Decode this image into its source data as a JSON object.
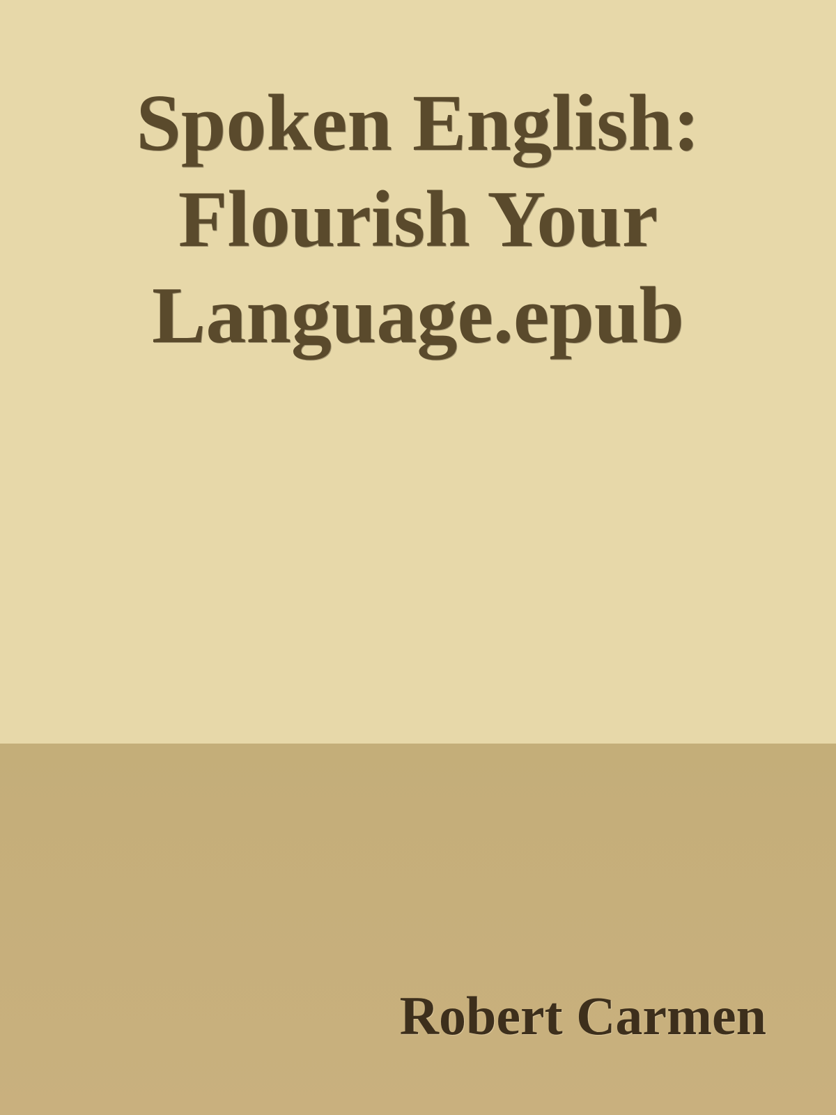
{
  "cover": {
    "title": "Spoken English: Flourish Your Language.epub",
    "author": "Robert Carmen",
    "colors": {
      "top_background": "#e7d8a9",
      "bottom_background": "#c6af7b",
      "title_text": "#5a4a2c",
      "author_text": "#3d2f1c"
    }
  }
}
